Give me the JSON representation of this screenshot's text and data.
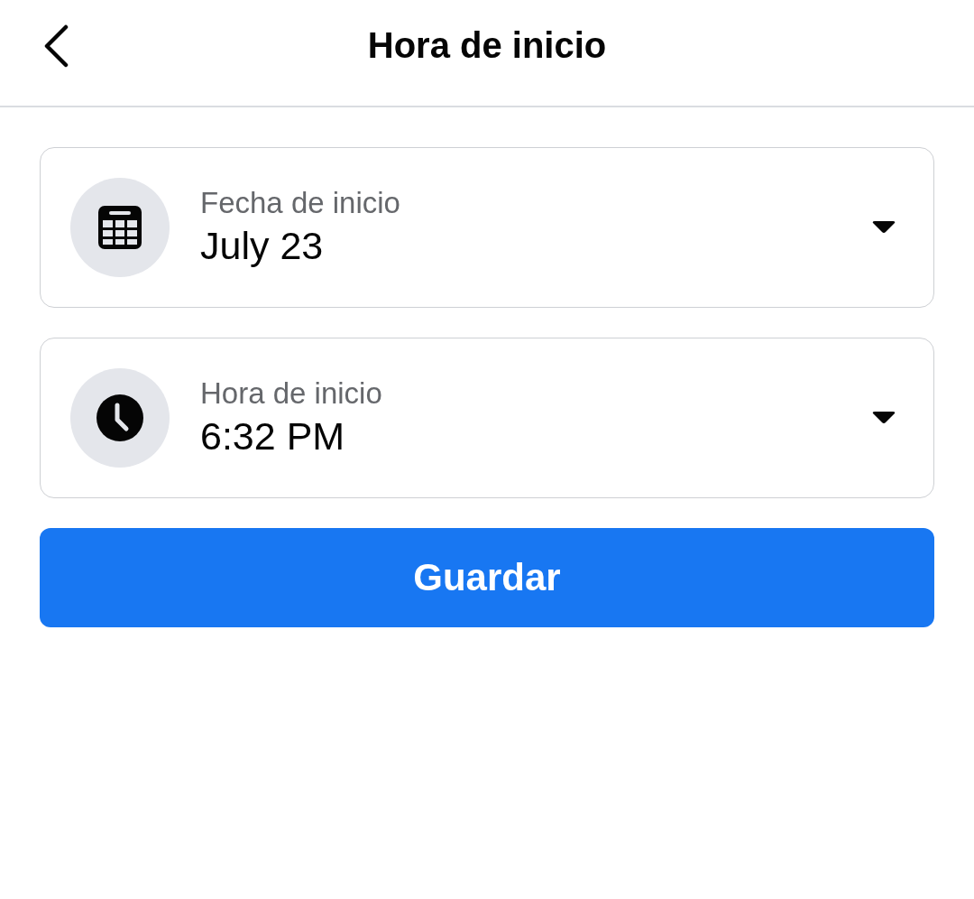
{
  "header": {
    "title": "Hora de inicio"
  },
  "fields": [
    {
      "kind": "date",
      "label": "Fecha de inicio",
      "value": "July 23"
    },
    {
      "kind": "time",
      "label": "Hora de inicio",
      "value": "6:32 PM"
    }
  ],
  "save_button": {
    "label": "Guardar"
  }
}
